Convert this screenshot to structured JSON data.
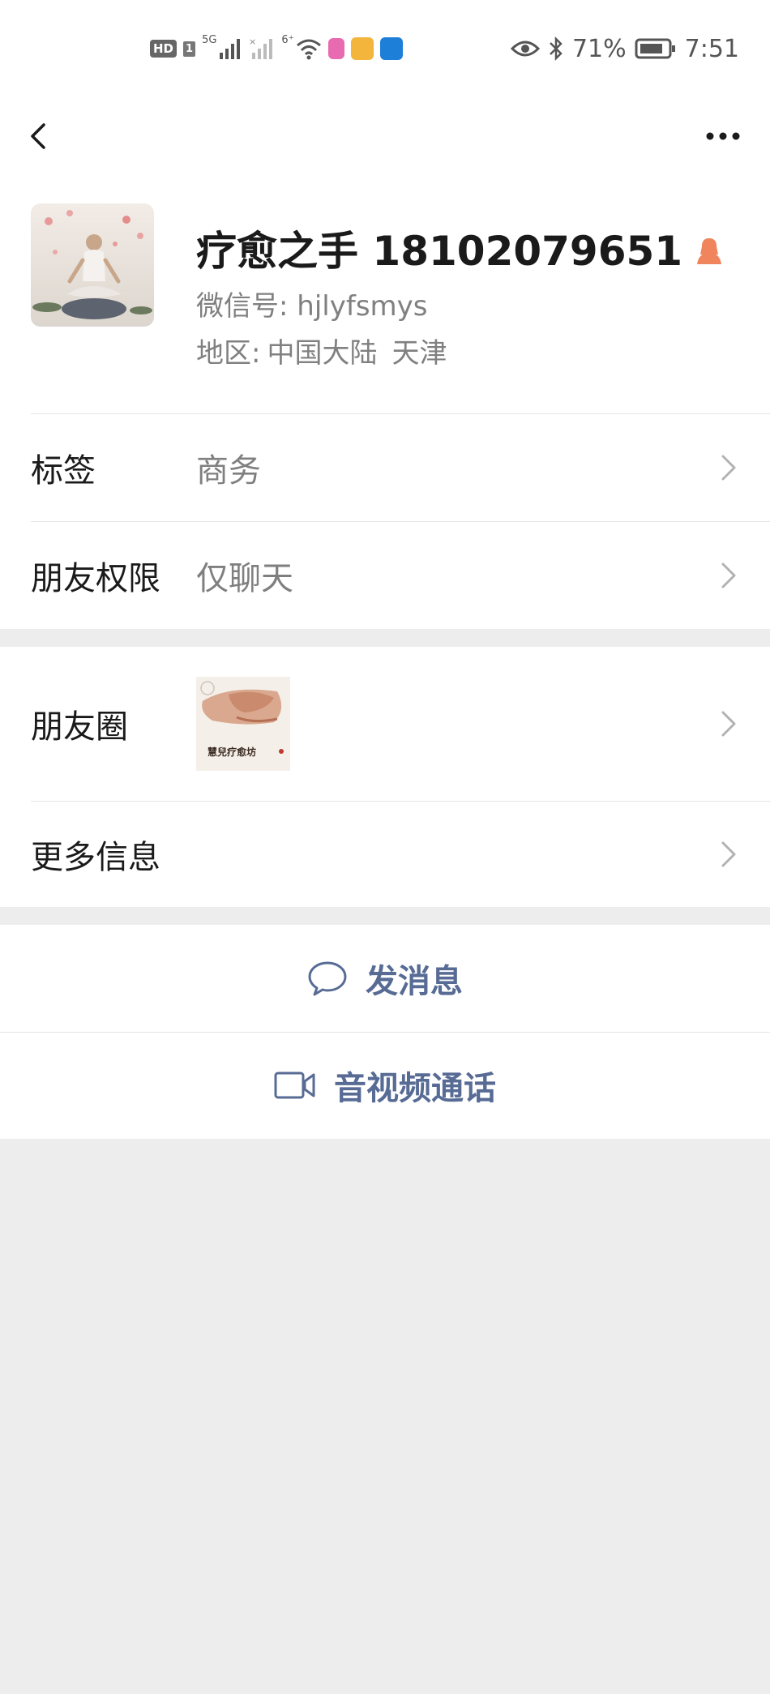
{
  "status_bar": {
    "hd": "HD",
    "sim": "1",
    "net_5g": "5G",
    "net_6": "6⁺",
    "battery": "71%",
    "time": "7:51",
    "app_colors": [
      "#e86ab0",
      "#f3b53c",
      "#1e7fd8"
    ]
  },
  "profile": {
    "name": "疗愈之手 18102079651",
    "wechat_id_label": "微信号:",
    "wechat_id": "hjlyfsmys",
    "region_label": "地区:",
    "region_country": "中国大陆",
    "region_city": "天津",
    "gender_icon": "female-icon",
    "gender_color": "#f0845d"
  },
  "rows": {
    "tags_label": "标签",
    "tags_value": "商务",
    "permission_label": "朋友权限",
    "permission_value": "仅聊天",
    "moments_label": "朋友圈",
    "moments_thumb_text": "慧兒疗愈坊",
    "more_info_label": "更多信息"
  },
  "actions": {
    "message_label": "发消息",
    "call_label": "音视频通话",
    "accent_color": "#576b95"
  }
}
